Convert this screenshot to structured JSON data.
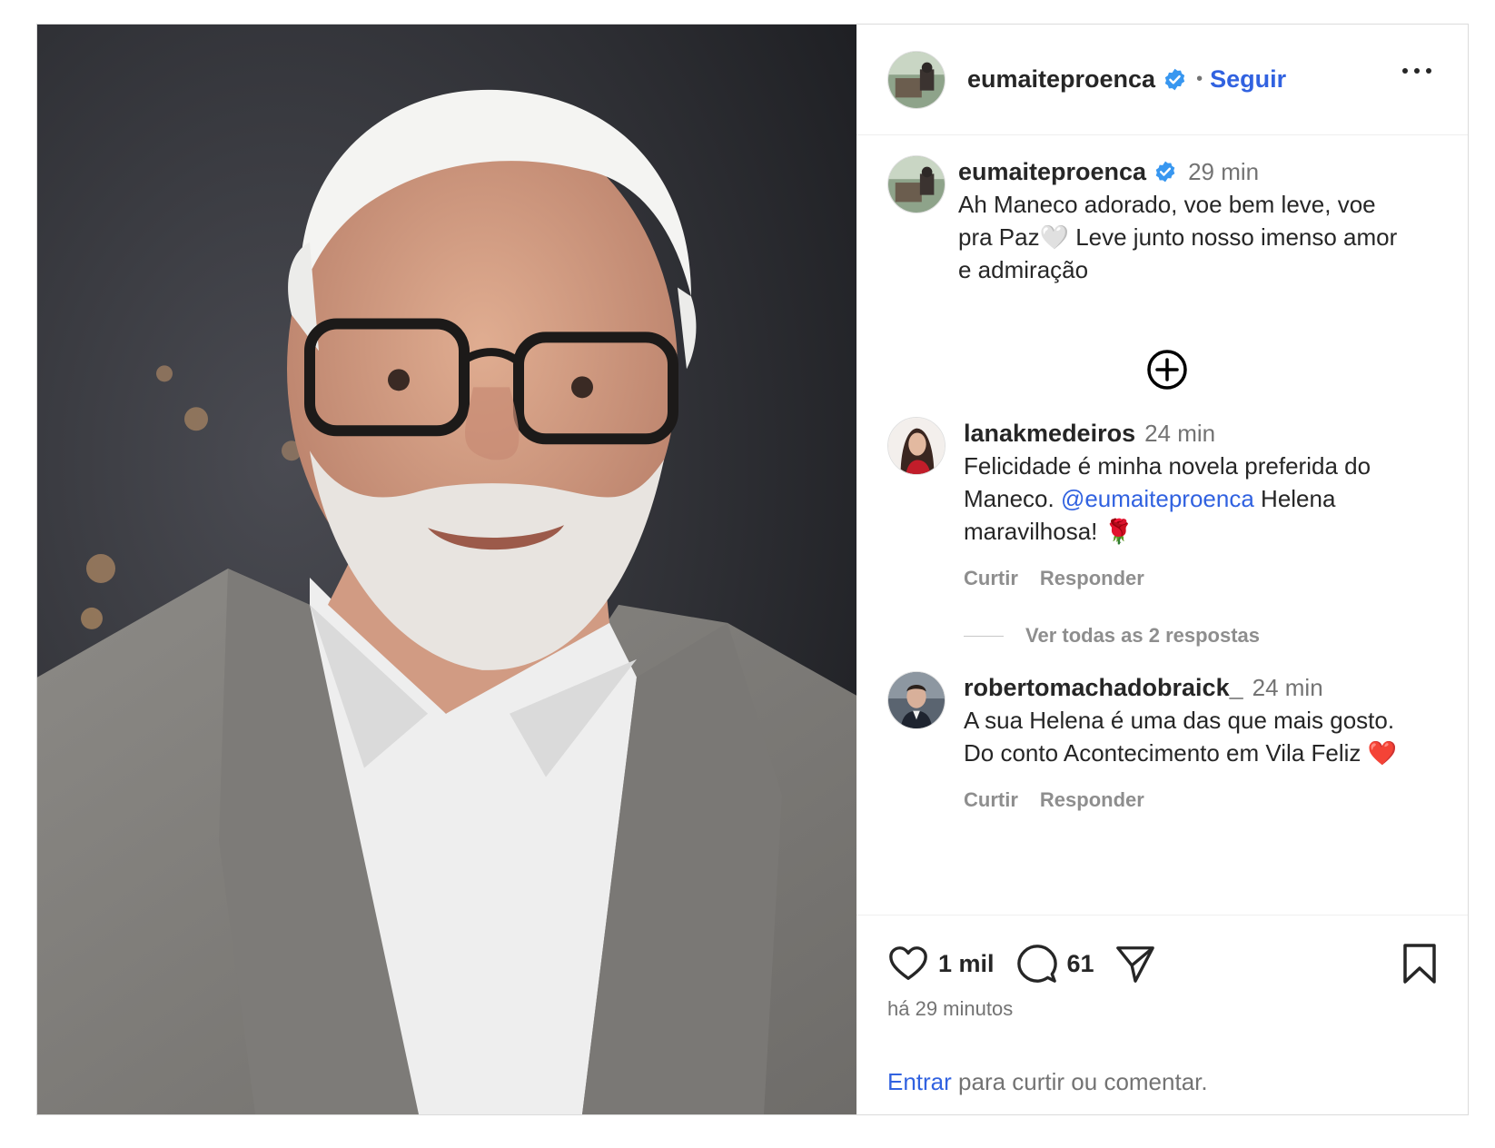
{
  "post": {
    "author": "eumaiteproenca",
    "follow_label": "Seguir",
    "caption": {
      "username": "eumaiteproenca",
      "time": "29 min",
      "text": "Ah Maneco adorado, voe bem leve, voe pra Paz🤍  Leve junto  nosso imenso amor e admiração"
    },
    "comments": [
      {
        "username": "lanakmedeiros",
        "time": "24 min",
        "text_before": "Felicidade é minha novela preferida do Maneco. ",
        "mention": "@eumaiteproenca",
        "text_after": " Helena maravilhosa! 🌹",
        "like_label": "Curtir",
        "reply_label": "Responder"
      },
      {
        "username": "robertomachadobraick_",
        "time": "24 min",
        "text": "A sua Helena é uma das que mais gosto. Do conto Acontecimento em Vila Feliz ❤️",
        "like_label": "Curtir",
        "reply_label": "Responder"
      }
    ],
    "view_replies": "Ver todas as 2 respostas",
    "likes": "1 mil",
    "comments_count": "61",
    "posted_ago": "há 29 minutos",
    "login_link": "Entrar",
    "login_text": " para curtir ou comentar."
  },
  "colors": {
    "link": "#3162e0",
    "verified": "#3897f0",
    "muted": "#737373"
  },
  "icons": [
    "verified-icon",
    "more-icon",
    "add-circle-icon",
    "heart-icon",
    "comment-icon",
    "share-icon",
    "bookmark-icon"
  ]
}
